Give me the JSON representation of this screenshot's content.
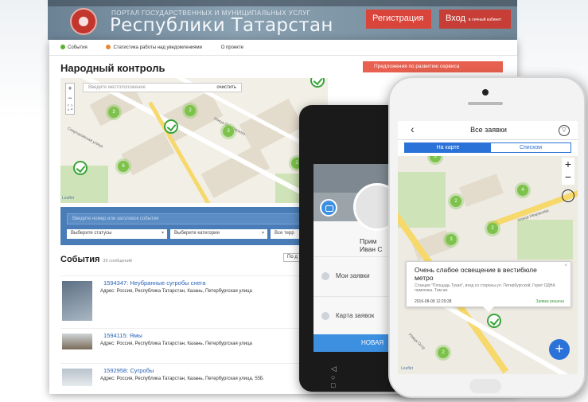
{
  "banner": {
    "subtitle": "ПОРТАЛ ГОСУДАРСТВЕННЫХ И МУНИЦИПАЛЬНЫХ УСЛУГ",
    "title": "Республики Татарстан",
    "register": "Регистрация",
    "login": "Вход",
    "login_small": "в личный кабинет"
  },
  "subnav": {
    "events": "События",
    "stats": "Статистика работы над уведомлениями",
    "about": "О проекте"
  },
  "page": {
    "title": "Народный контроль",
    "suggest_button": "Предложения по развитию сервиса"
  },
  "map": {
    "search_placeholder": "Введите местоположение",
    "clear": "очистить",
    "street": "Улица Островского",
    "street2": "Спартаковская улица",
    "attribution": "Leaflet",
    "clusters": [
      "3",
      "2",
      "3",
      "6",
      "2"
    ]
  },
  "filters": {
    "search_placeholder": "Введите номер или заголовок события",
    "status": "Выберите статусы",
    "category": "Выберите категории",
    "all": "Все терр"
  },
  "events": {
    "heading": "События",
    "count": "39 сообщений",
    "sort": "По д",
    "items": [
      {
        "title": "1594347: Неубранные сугробы снега",
        "address": "Адрес: Россия, Республика Татарстан, Казань, Петербургская улица"
      },
      {
        "title": "1594115: Ямы",
        "address": "Адрес: Россия, Республика Татарстан, Казань, Петербургская улица"
      },
      {
        "title": "1592958: Сугробы",
        "address": "Адрес: Россия, Республика Татарстан, Казань, Петербургская улица, 55Б"
      }
    ]
  },
  "android": {
    "name1": "Прим",
    "name2": "Иван С",
    "my_requests": "Мои заявки",
    "requests_map": "Карта заявок",
    "new_button": "НОВАЯ",
    "nav": "◁ ○ □"
  },
  "iphone": {
    "title": "Все заявки",
    "tab_map": "На карте",
    "tab_list": "Списком",
    "popup_title": "Очень слабое освещение в вестибюле метро",
    "popup_address": "Станция \"Площадь Тукая\", вход со стороны ул. Петербургской. Горит ОДНА лампочка. Там же",
    "popup_date": "2016-08-09 12:29:28",
    "popup_status": "Заявка решена",
    "street": "Улица Некрасова",
    "street2": "Улица Остр",
    "attribution": "Leaflet",
    "clusters": [
      "3",
      "4",
      "2",
      "3",
      "2",
      "2"
    ]
  },
  "colors": {
    "accent_red": "#d9443b",
    "accent_blue": "#2b72d8",
    "cluster_green": "#7cc24b"
  }
}
